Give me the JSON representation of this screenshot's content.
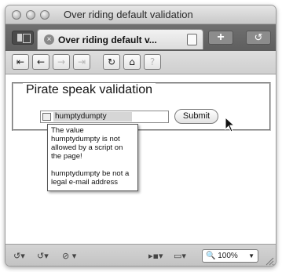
{
  "window": {
    "title": "Over riding default validation"
  },
  "tabs": {
    "active_label": "Over riding default v...",
    "close_glyph": "×",
    "new_tab_glyph": "+",
    "history_glyph": "↺"
  },
  "nav": {
    "first": "⇤",
    "back": "←",
    "forward": "→",
    "last": "⇥",
    "reload": "↻",
    "home": "⌂",
    "help": "?"
  },
  "form": {
    "legend": "Pirate speak validation",
    "email_value": "humptydumpty",
    "submit_label": "Submit"
  },
  "tooltip": {
    "line1": "The value humptydumpty is not allowed by a script on the page!",
    "line2": "humptydumpty be not a legal e-mail address"
  },
  "statusbar": {
    "tools1": "↺▾",
    "tools2": "↺▾",
    "tools3": "⊘ ▾",
    "tools4": "▸▪▾",
    "tools5": "▭▾",
    "zoom_icon": "🔍",
    "zoom_value": "100%",
    "zoom_arrow": "▼"
  }
}
